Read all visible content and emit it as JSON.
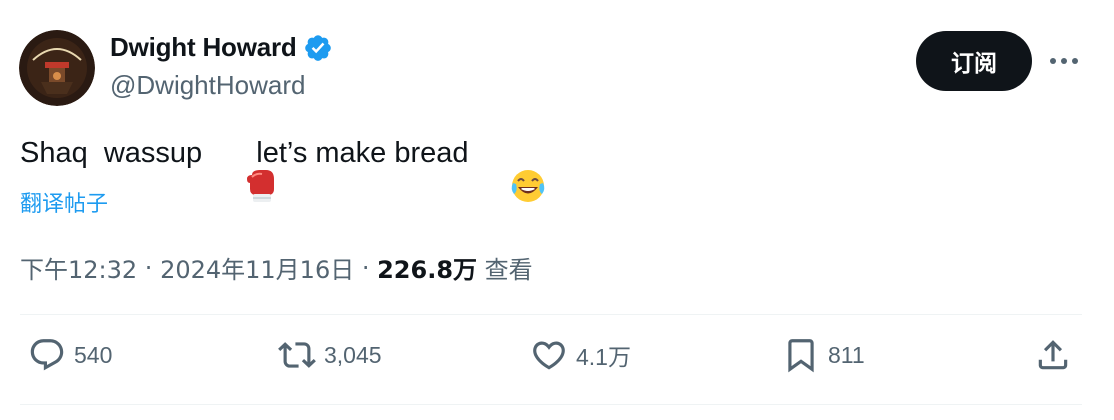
{
  "author": {
    "display_name": "Dwight Howard",
    "handle": "@DwightHoward",
    "verified": true,
    "avatar_icon": "avatar-icon"
  },
  "header": {
    "subscribe_label": "订阅",
    "more_icon": "more-icon"
  },
  "tweet": {
    "text_part1": "Shaq  wassup ",
    "emoji1": "boxing-glove-emoji",
    "text_part2": " let’s make bread ",
    "emoji2": "face-with-tears-of-joy-emoji",
    "translate_label": "翻译帖子"
  },
  "meta": {
    "time": "下午12:32",
    "date": "2024年11月16日",
    "separator": " · ",
    "views_count": "226.8万",
    "views_label": " 查看"
  },
  "actions": {
    "replies": "540",
    "retweets": "3,045",
    "likes": "4.1万",
    "bookmarks": "811"
  },
  "colors": {
    "accent": "#1d9bf0",
    "text_primary": "#0f1419",
    "text_secondary": "#536471",
    "divider": "#eff3f4"
  }
}
